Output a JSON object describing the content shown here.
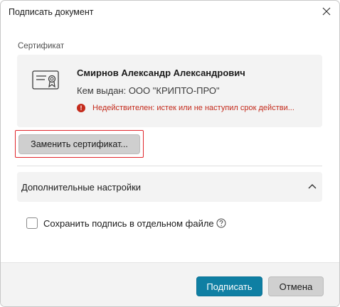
{
  "window": {
    "title": "Подписать документ",
    "close_icon": "close-icon"
  },
  "certificate": {
    "section_label": "Сертификат",
    "icon": "certificate-icon",
    "owner_name": "Смирнов Александр Александрович",
    "issuer": "Кем выдан: ООО \"КРИПТО-ПРО\"",
    "status_icon": "error-icon",
    "status_text": "Недействителен: истек или не наступил срок действи...",
    "replace_label": "Заменить сертификат..."
  },
  "advanced": {
    "label": "Дополнительные настройки",
    "chevron": "chevron-up-icon",
    "save_separate_label": "Сохранить подпись в отдельном файле",
    "save_separate_checked": false,
    "help_icon": "help-icon"
  },
  "footer": {
    "sign_label": "Подписать",
    "cancel_label": "Отмена"
  },
  "colors": {
    "accent": "#0f7fa3",
    "error": "#c42b1c",
    "highlight_border": "#e0252b"
  }
}
